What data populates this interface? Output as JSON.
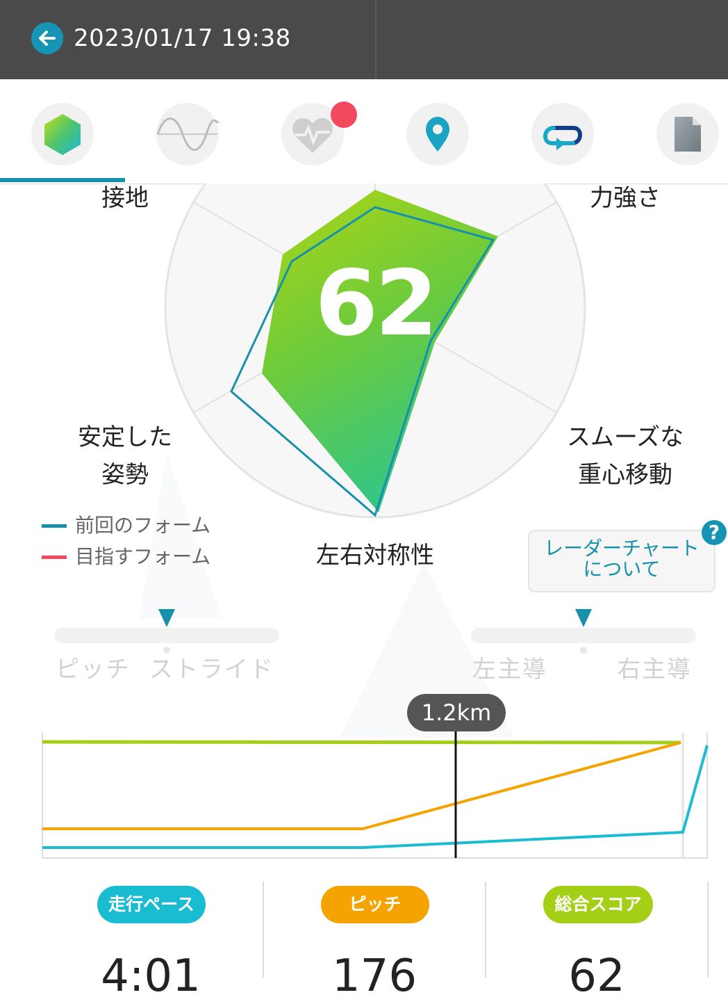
{
  "header": {
    "title": "2023/01/17 19:38",
    "back_icon": "arrow-left-icon"
  },
  "tabs": [
    {
      "icon": "hexagon-score-icon",
      "active": true
    },
    {
      "icon": "wave-icon",
      "active": false
    },
    {
      "icon": "heart-rate-icon",
      "active": false,
      "notification": true
    },
    {
      "icon": "location-pin-icon",
      "active": false
    },
    {
      "icon": "loop-icon",
      "active": false
    },
    {
      "icon": "document-icon",
      "active": false
    }
  ],
  "radar": {
    "score": "62",
    "axes": {
      "top_left": "接地",
      "top_right": "力強さ",
      "left_line1": "安定した",
      "left_line2": "姿勢",
      "right_line1": "スムーズな",
      "right_line2": "重心移動",
      "bottom": "左右対称性"
    }
  },
  "legend": [
    {
      "label": "前回のフォーム",
      "color": "#1790ab"
    },
    {
      "label": "目指すフォーム",
      "color": "#f4485f"
    }
  ],
  "about": {
    "line1": "レーダーチャート",
    "line2": "について",
    "help": "?"
  },
  "sliders": [
    {
      "left": "ピッチ",
      "right": "ストライド"
    },
    {
      "left": "左主導",
      "right": "右主導"
    }
  ],
  "chart": {
    "marker_label": "1.2km",
    "colors": {
      "pace": "#19bcd0",
      "pitch": "#f5a300",
      "total": "#a5cf17"
    }
  },
  "metrics": [
    {
      "label": "走行ペース",
      "value": "4:01",
      "color": "#19bcd0"
    },
    {
      "label": "ピッチ",
      "value": "176",
      "color": "#f5a300"
    },
    {
      "label": "総合スコア",
      "value": "62",
      "color": "#a5cf17"
    }
  ]
}
